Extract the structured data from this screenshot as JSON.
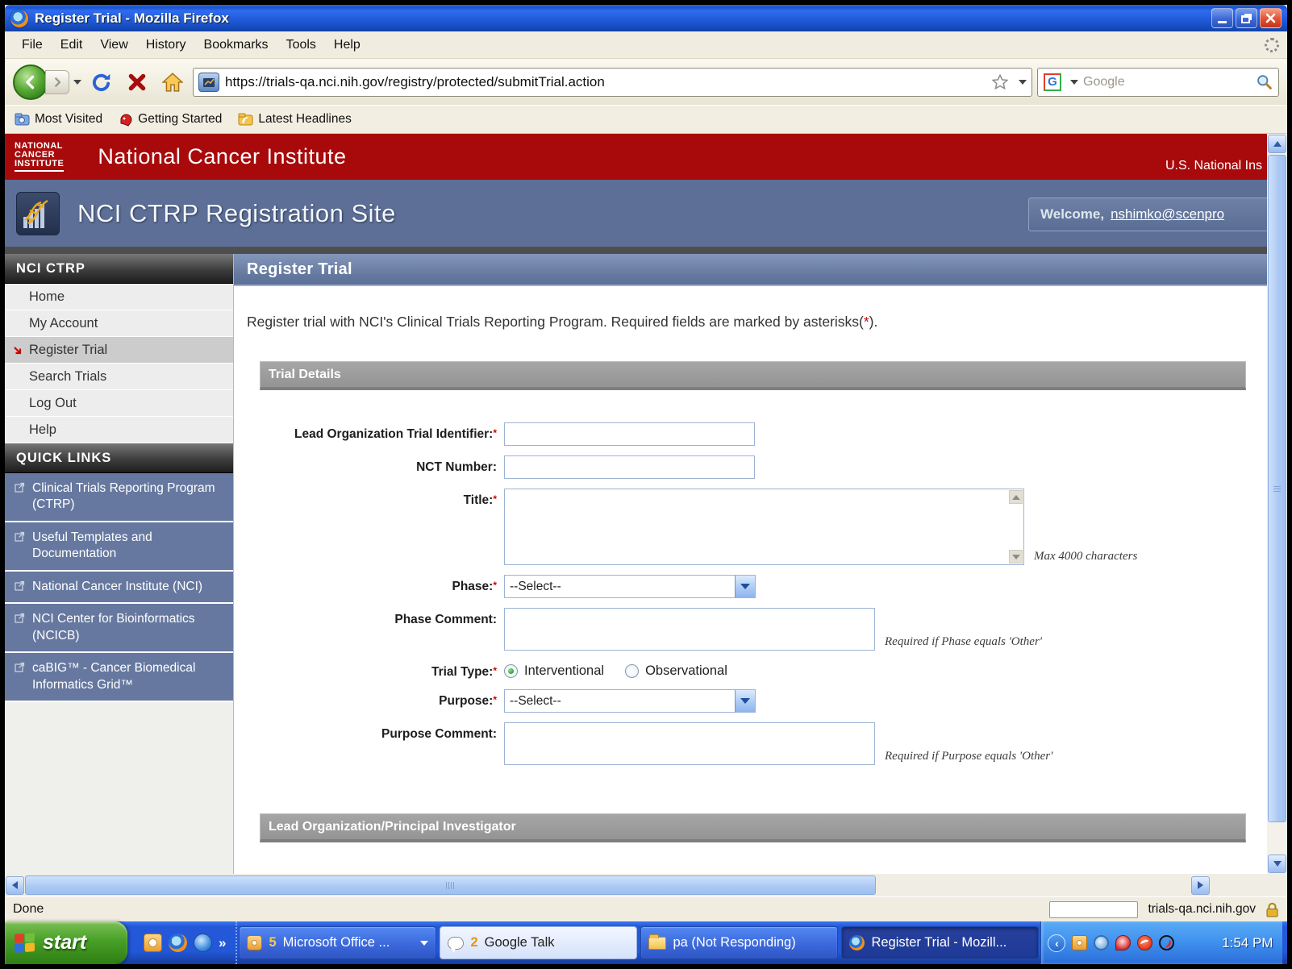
{
  "window": {
    "title": "Register Trial - Mozilla Firefox"
  },
  "menu": {
    "items": [
      "File",
      "Edit",
      "View",
      "History",
      "Bookmarks",
      "Tools",
      "Help"
    ]
  },
  "toolbar": {
    "url": "https://trials-qa.nci.nih.gov/registry/protected/submitTrial.action",
    "search_placeholder": "Google",
    "search_engine_letter": "G"
  },
  "bookmarks_bar": {
    "items": [
      "Most Visited",
      "Getting Started",
      "Latest Headlines"
    ]
  },
  "nci_header": {
    "logo_lines": [
      "NATIONAL",
      "CANCER",
      "INSTITUTE"
    ],
    "title": "National Cancer Institute",
    "right_text": "U.S. National Ins"
  },
  "banner": {
    "site_title": "NCI CTRP Registration Site",
    "welcome_label": "Welcome,",
    "welcome_user": "nshimko@scenpro"
  },
  "sidebar": {
    "nav_title": "NCI CTRP",
    "items": [
      {
        "label": "Home"
      },
      {
        "label": "My Account"
      },
      {
        "label": "Register Trial"
      },
      {
        "label": "Search Trials"
      },
      {
        "label": "Log Out"
      },
      {
        "label": "Help"
      }
    ],
    "quick_links_title": "QUICK LINKS",
    "quick_links": [
      {
        "label": "Clinical Trials Reporting Program (CTRP)"
      },
      {
        "label": "Useful Templates and Documentation"
      },
      {
        "label": "National Cancer Institute (NCI)"
      },
      {
        "label": "NCI Center for Bioinformatics (NCICB)"
      },
      {
        "label": "caBIG™ - Cancer Biomedical Informatics Grid™"
      }
    ]
  },
  "main": {
    "page_title": "Register Trial",
    "intro_before": "Register trial with NCI's Clinical Trials Reporting Program. Required fields are marked by asterisks(",
    "required_star": "*",
    "intro_after": ").",
    "section_trial_details": "Trial Details",
    "section_lead_org": "Lead Organization/Principal Investigator",
    "fields": {
      "lead_org_id_label": "Lead Organization Trial Identifier:",
      "nct_number_label": "NCT Number:",
      "title_label": "Title:",
      "title_note": "Max 4000 characters",
      "phase_label": "Phase:",
      "phase_value": "--Select--",
      "phase_comment_label": "Phase Comment:",
      "phase_comment_note": "Required if Phase equals 'Other'",
      "trial_type_label": "Trial Type:",
      "trial_type_option1": "Interventional",
      "trial_type_option2": "Observational",
      "purpose_label": "Purpose:",
      "purpose_value": "--Select--",
      "purpose_comment_label": "Purpose Comment:",
      "purpose_comment_note": "Required if Purpose equals 'Other'"
    }
  },
  "statusbar": {
    "status": "Done",
    "domain": "trials-qa.nci.nih.gov"
  },
  "taskbar": {
    "start_label": "start",
    "quick_launch_more": "»",
    "buttons": [
      {
        "count": "5",
        "label": "Microsoft Office ..."
      },
      {
        "count": "2",
        "label": "Google Talk"
      },
      {
        "count": "",
        "label": "pa (Not Responding)"
      },
      {
        "count": "",
        "label": "Register Trial - Mozill..."
      }
    ],
    "clock": "1:54 PM"
  },
  "colors": {
    "nci_red": "#a80a0c",
    "banner_blue": "#5d6f96",
    "required_red": "#cc0000",
    "xp_taskbar_blue": "#2458d8"
  }
}
